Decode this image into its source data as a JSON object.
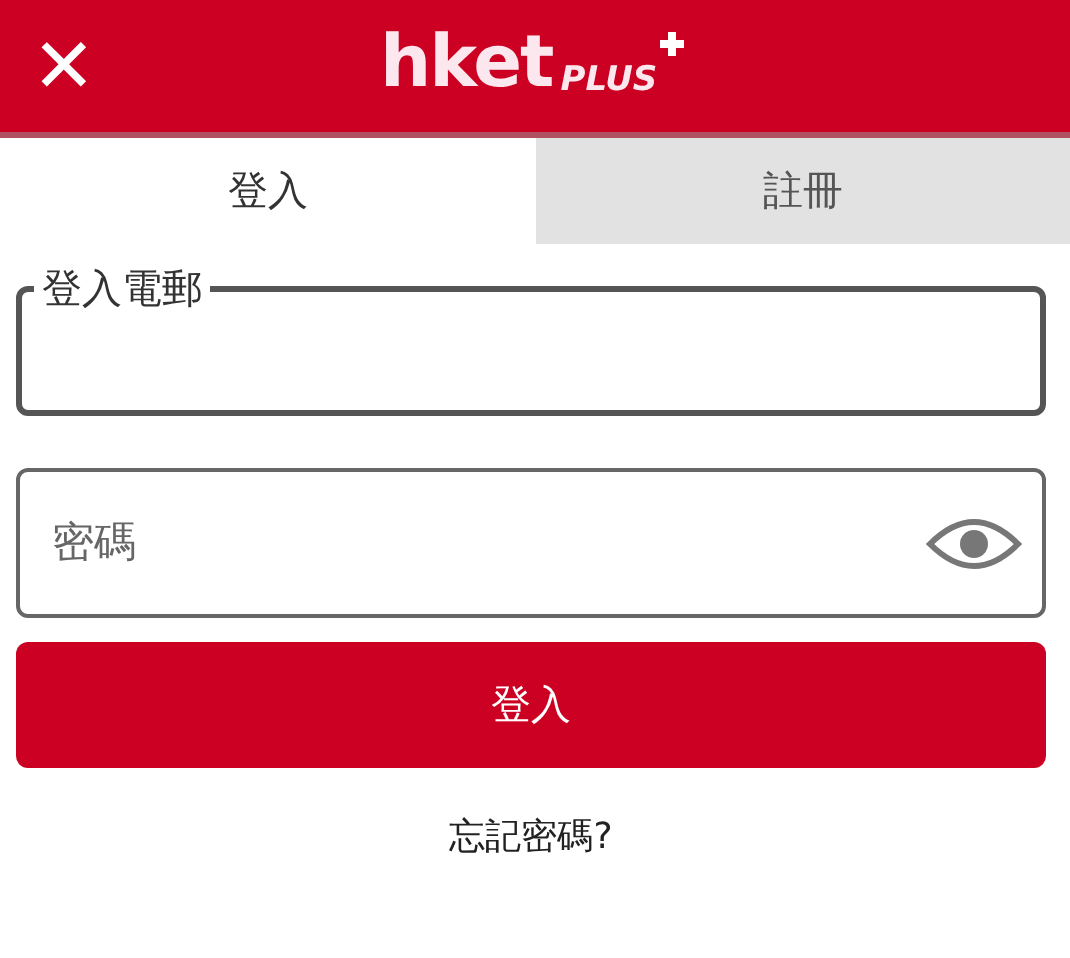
{
  "header": {
    "close": "✕",
    "logo": {
      "main": "hket",
      "sub": "PLUS"
    }
  },
  "tabs": [
    {
      "label": "登入",
      "selected": true
    },
    {
      "label": "註冊",
      "selected": false
    }
  ],
  "email": {
    "label": "登入電郵",
    "focused": true
  },
  "password": {
    "placeholder": "密碼"
  },
  "submit": "登入",
  "forgot": "忘記密碼?"
}
